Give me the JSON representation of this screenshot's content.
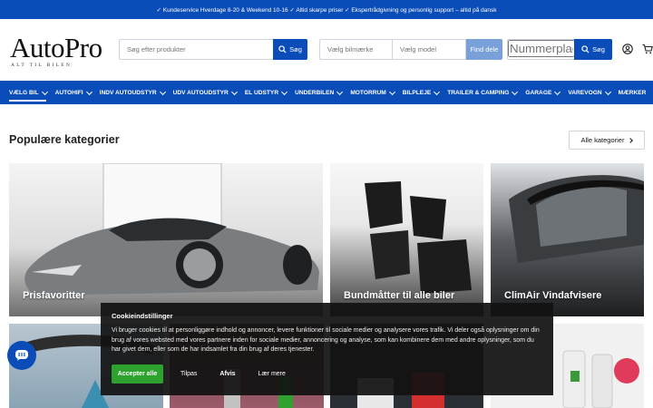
{
  "topbar": {
    "text": "✓ Kundeservice Hverdage 8-20 & Weekend 10-16 ✓ Altid skarpe priser ✓ Ekspertrådgivning og personlig support – altid på dansk"
  },
  "header": {
    "logo_main": "AutoPro",
    "logo_sub": "ALT TIL BILEN",
    "search_placeholder": "Søg efter produkter",
    "search_button": "Søg",
    "brand_placeholder": "Vælg bilmærke",
    "model_placeholder": "Vælg model",
    "find_parts_button": "Find dele",
    "plate_placeholder": "Nummerplade",
    "plate_button": "Søg"
  },
  "nav": {
    "items": [
      {
        "label": "VÆLG BIL"
      },
      {
        "label": "AUTOHIFI"
      },
      {
        "label": "INDV AUTOUDSTYR"
      },
      {
        "label": "UDV AUTOUDSTYR"
      },
      {
        "label": "EL UDSTYR"
      },
      {
        "label": "UNDERBILEN"
      },
      {
        "label": "MOTORRUM"
      },
      {
        "label": "BILPLEJE"
      },
      {
        "label": "TRAILER & CAMPING"
      },
      {
        "label": "GARAGE"
      },
      {
        "label": "VAREVOGN"
      },
      {
        "label": "MÆRKER"
      }
    ]
  },
  "main": {
    "section_title": "Populære kategorier",
    "all_categories_button": "Alle kategorier",
    "tiles": [
      {
        "label": "Prisfavoritter"
      },
      {
        "label": "Bundmåtter til alle biler"
      },
      {
        "label": "ClimAir Vindafvisere"
      }
    ]
  },
  "cookie": {
    "title": "Cookieindstillinger",
    "text": "Vi bruger cookies til at personliggøre indhold og annoncer, levere funktioner til sociale medier og analysere vores trafik. Vi deler også oplysninger om din brug af vores websted med vores partnere inden for sociale medier, annoncering og analyse, som kan kombinere dem med andre oplysninger, som du har givet dem, eller som de har indsamlet fra din brug af deres tjenester.",
    "accept": "Accepter alle",
    "customize": "Tilpas",
    "reject": "Afvis",
    "learn_more": "Lær mere"
  },
  "colors": {
    "brand_blue": "#0a4db8",
    "accept_green": "#2ea22e"
  }
}
